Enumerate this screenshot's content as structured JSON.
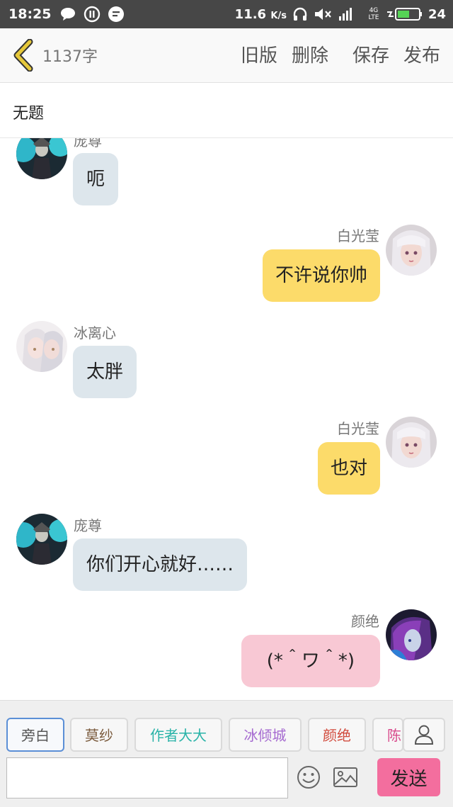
{
  "status_bar": {
    "time": "18:25",
    "speed": "11.6",
    "speed_unit": "K/s",
    "network": "4G LTE",
    "battery": "24"
  },
  "header": {
    "word_count": "1137字",
    "actions": {
      "old_version": "旧版",
      "delete": "删除",
      "save": "保存",
      "publish": "发布"
    }
  },
  "document": {
    "title": "无题"
  },
  "messages": [
    {
      "side": "left",
      "sender": "庞尊",
      "text": "呃",
      "color": "blue",
      "avatar": "dark-armored-character-avatar"
    },
    {
      "side": "right",
      "sender": "白光莹",
      "text": "不许说你帅",
      "color": "yellow",
      "avatar": "white-haired-girl-avatar"
    },
    {
      "side": "left",
      "sender": "冰离心",
      "text": "太胖",
      "color": "blue",
      "avatar": "silver-haired-couple-avatar"
    },
    {
      "side": "right",
      "sender": "白光莹",
      "text": "也对",
      "color": "yellow",
      "avatar": "white-haired-girl-avatar"
    },
    {
      "side": "left",
      "sender": "庞尊",
      "text": "你们开心就好……",
      "color": "blue",
      "avatar": "dark-armored-character-avatar"
    },
    {
      "side": "right",
      "sender": "颜绝",
      "text": "(*＾ワ＾*)",
      "color": "pink",
      "avatar": "purple-haired-girl-avatar"
    }
  ],
  "characters": [
    {
      "label": "旁白",
      "color": "#555555",
      "active": true
    },
    {
      "label": "莫纱",
      "color": "#7a5a3c",
      "active": false
    },
    {
      "label": "作者大大",
      "color": "#2ab3a8",
      "active": false
    },
    {
      "label": "冰倾城",
      "color": "#a56ad0",
      "active": false
    },
    {
      "label": "颜绝",
      "color": "#d14a3c",
      "active": false
    },
    {
      "label": "陈",
      "color": "#d94b8c",
      "active": false
    }
  ],
  "composer": {
    "input_value": "",
    "send_label": "发送"
  },
  "colors": {
    "accent_back": "#e6c83a",
    "bubble_blue": "#dde6ec",
    "bubble_yellow": "#fcdb6a",
    "bubble_pink": "#f8c8d4",
    "send_button": "#f36e9e"
  },
  "icons": [
    "chat-icon",
    "pause-icon",
    "message-icon",
    "headphones-icon",
    "mute-icon",
    "signal-icon",
    "battery-icon",
    "back-chevron-icon",
    "person-icon",
    "emoji-icon",
    "image-icon"
  ]
}
